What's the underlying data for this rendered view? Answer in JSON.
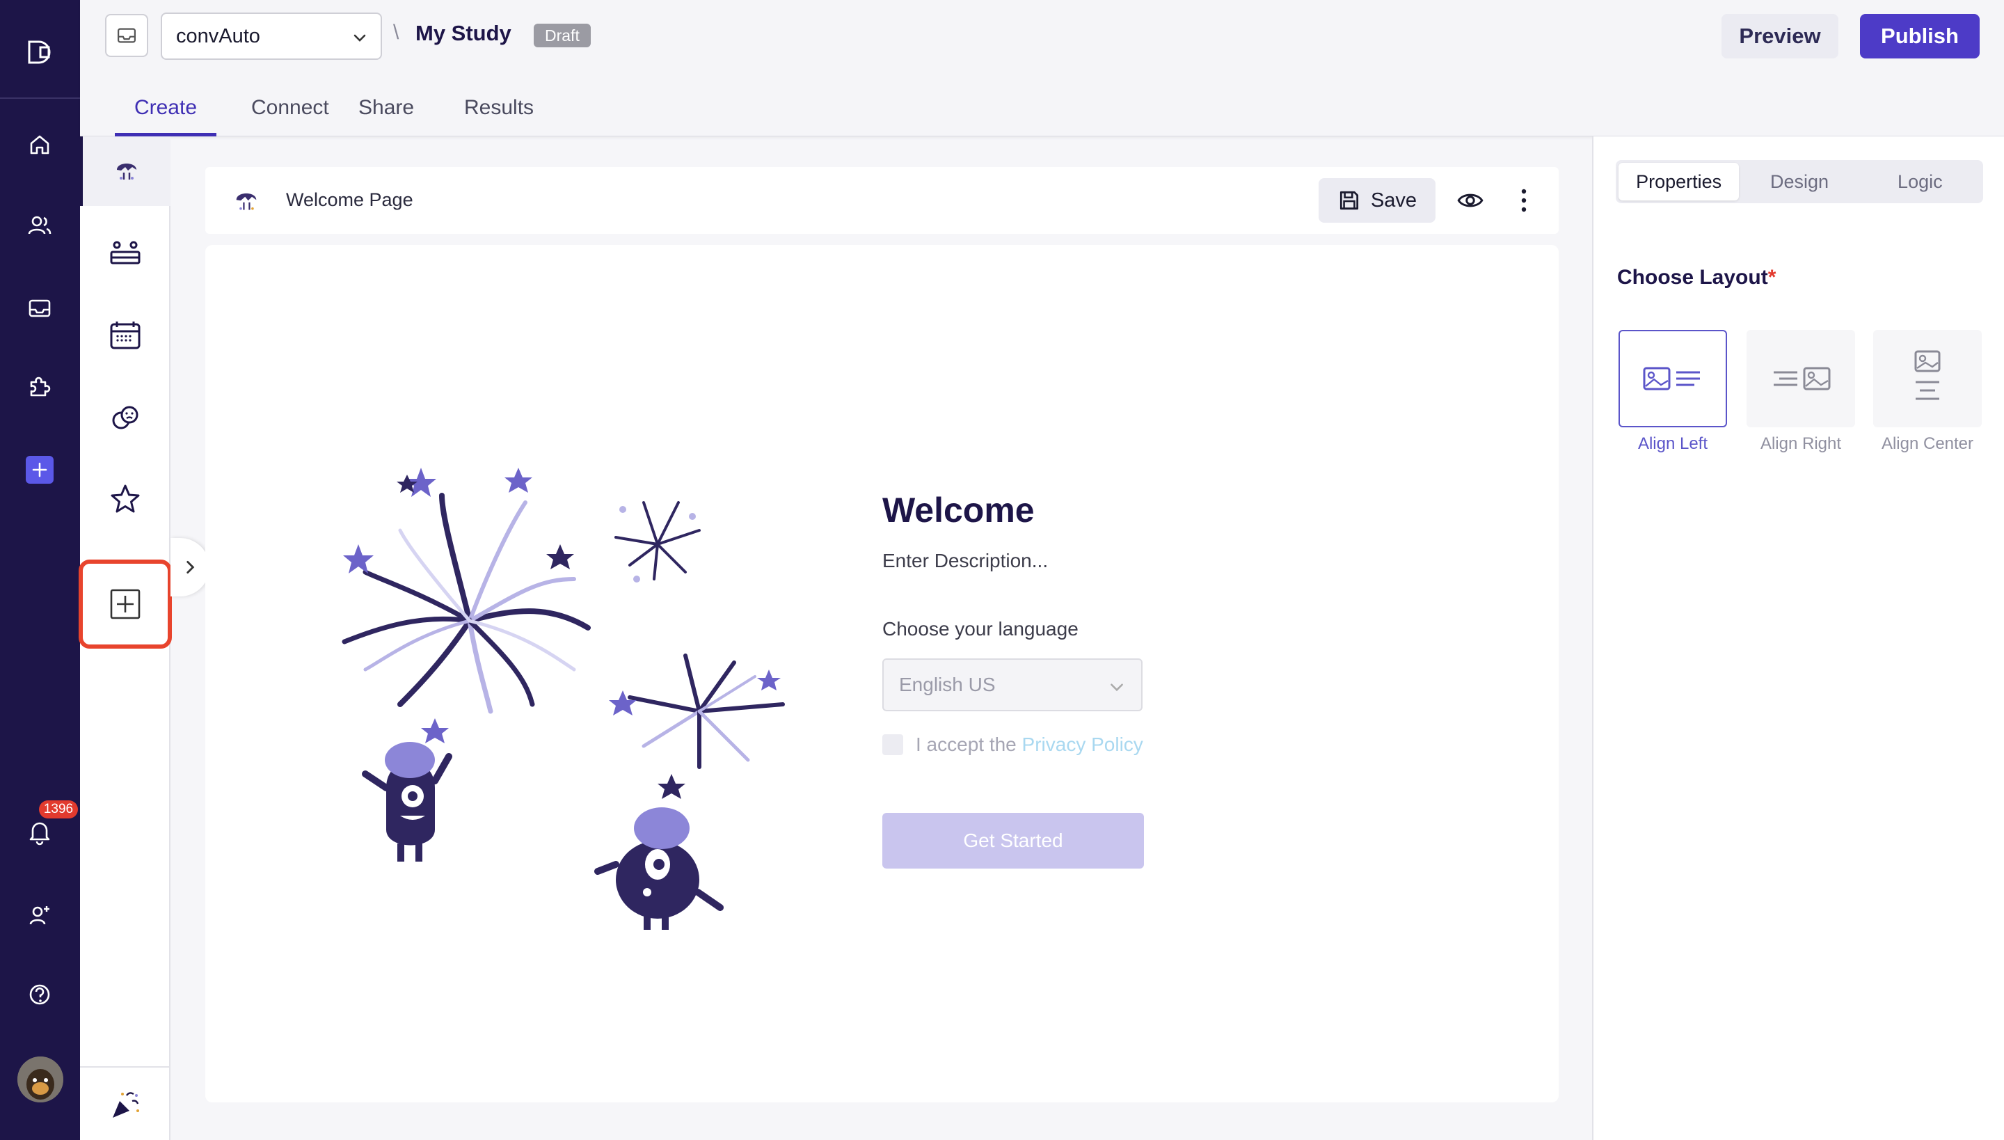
{
  "header": {
    "workspace": "convAuto",
    "separator": "\\",
    "study_title": "My Study",
    "status_badge": "Draft",
    "preview_label": "Preview",
    "publish_label": "Publish",
    "tabs": [
      {
        "label": "Create",
        "active": true
      },
      {
        "label": "Connect",
        "active": false
      },
      {
        "label": "Share",
        "active": false
      },
      {
        "label": "Results",
        "active": false
      }
    ]
  },
  "leftnav": {
    "icons": [
      "logo-icon",
      "home-icon",
      "users-icon",
      "inbox-icon",
      "puzzle-icon",
      "add-icon",
      "bell-icon",
      "add-user-icon",
      "help-icon"
    ],
    "notification_count": "1396"
  },
  "sections": {
    "items": [
      "welcome-icon",
      "intro-icon",
      "calendar-icon",
      "chat-faces-icon",
      "star-icon"
    ],
    "add_icon": "add-section-icon",
    "end_icon": "celebration-icon"
  },
  "page": {
    "title": "Welcome Page",
    "save_label": "Save"
  },
  "welcome": {
    "title": "Welcome",
    "description": "Enter Description...",
    "language_label": "Choose your language",
    "language_value": "English US",
    "accept_text": "I accept the",
    "privacy_link": "Privacy Policy",
    "cta": "Get Started"
  },
  "rightpanel": {
    "tabs": [
      {
        "label": "Properties",
        "active": true
      },
      {
        "label": "Design",
        "active": false
      },
      {
        "label": "Logic",
        "active": false
      }
    ],
    "layout_title": "Choose Layout",
    "required_mark": "*",
    "layouts": [
      {
        "label": "Align Left",
        "selected": true
      },
      {
        "label": "Align Right",
        "selected": false
      },
      {
        "label": "Align Center",
        "selected": false
      }
    ]
  },
  "colors": {
    "nav_bg": "#1d1548",
    "accent": "#4d3bc7",
    "highlight": "#e8442d"
  }
}
